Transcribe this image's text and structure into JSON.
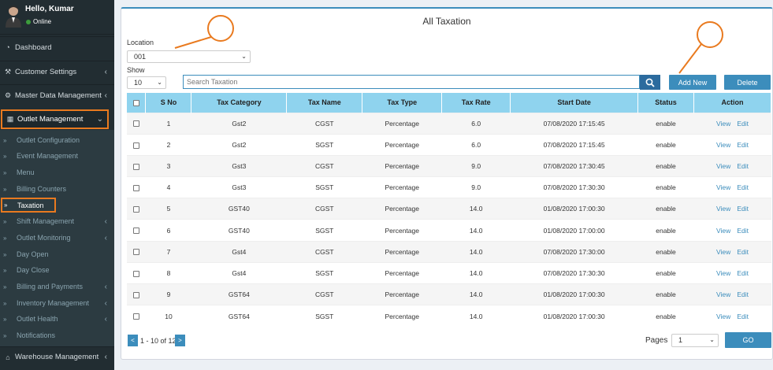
{
  "user": {
    "greeting": "Hello, Kumar",
    "status": "Online"
  },
  "sidebar": {
    "items": [
      {
        "label": "Dashboard",
        "icon": "dashboard-icon"
      },
      {
        "label": "Customer Settings",
        "icon": "wrench-icon"
      },
      {
        "label": "Master Data Management",
        "icon": "gear-icon"
      },
      {
        "label": "Outlet Management",
        "icon": "outlet-icon"
      }
    ],
    "subitems": [
      "Outlet Configuration",
      "Event Management",
      "Menu",
      "Billing Counters",
      "Taxation",
      "Shift Management",
      "Outlet Monitoring",
      "Day Open",
      "Day Close",
      "Billing and Payments",
      "Inventory Management",
      "Outlet Health",
      "Notifications"
    ],
    "bottom_item": {
      "label": "Warehouse Management",
      "icon": "home-icon"
    }
  },
  "page": {
    "title": "All Taxation",
    "location_label": "Location",
    "location_value": "001",
    "show_label": "Show",
    "show_value": "10",
    "search_placeholder": "Search Taxation",
    "add_new_label": "Add New",
    "delete_label": "Delete"
  },
  "table": {
    "headers": [
      "S No",
      "Tax Category",
      "Tax Name",
      "Tax Type",
      "Tax Rate",
      "Start Date",
      "Status",
      "Action"
    ],
    "view_label": "View",
    "edit_label": "Edit",
    "rows": [
      {
        "sno": "1",
        "category": "Gst2",
        "name": "CGST",
        "type": "Percentage",
        "rate": "6.0",
        "start": "07/08/2020 17:15:45",
        "status": "enable"
      },
      {
        "sno": "2",
        "category": "Gst2",
        "name": "SGST",
        "type": "Percentage",
        "rate": "6.0",
        "start": "07/08/2020 17:15:45",
        "status": "enable"
      },
      {
        "sno": "3",
        "category": "Gst3",
        "name": "CGST",
        "type": "Percentage",
        "rate": "9.0",
        "start": "07/08/2020 17:30:45",
        "status": "enable"
      },
      {
        "sno": "4",
        "category": "Gst3",
        "name": "SGST",
        "type": "Percentage",
        "rate": "9.0",
        "start": "07/08/2020 17:30:30",
        "status": "enable"
      },
      {
        "sno": "5",
        "category": "GST40",
        "name": "CGST",
        "type": "Percentage",
        "rate": "14.0",
        "start": "01/08/2020 17:00:30",
        "status": "enable"
      },
      {
        "sno": "6",
        "category": "GST40",
        "name": "SGST",
        "type": "Percentage",
        "rate": "14.0",
        "start": "01/08/2020 17:00:00",
        "status": "enable"
      },
      {
        "sno": "7",
        "category": "Gst4",
        "name": "CGST",
        "type": "Percentage",
        "rate": "14.0",
        "start": "07/08/2020 17:30:00",
        "status": "enable"
      },
      {
        "sno": "8",
        "category": "Gst4",
        "name": "SGST",
        "type": "Percentage",
        "rate": "14.0",
        "start": "07/08/2020 17:30:30",
        "status": "enable"
      },
      {
        "sno": "9",
        "category": "GST64",
        "name": "CGST",
        "type": "Percentage",
        "rate": "14.0",
        "start": "01/08/2020 17:00:30",
        "status": "enable"
      },
      {
        "sno": "10",
        "category": "GST64",
        "name": "SGST",
        "type": "Percentage",
        "rate": "14.0",
        "start": "01/08/2020 17:00:30",
        "status": "enable"
      }
    ]
  },
  "pagination": {
    "prev": "<",
    "range": "1 - 10 of 12",
    "next": ">",
    "pages_label": "Pages",
    "page_value": "1",
    "go_label": "GO"
  },
  "colors": {
    "sidebar": "#222d32",
    "accent": "#3c8dbc",
    "header": "#8fd3ee",
    "highlight": "#e97a1f"
  }
}
